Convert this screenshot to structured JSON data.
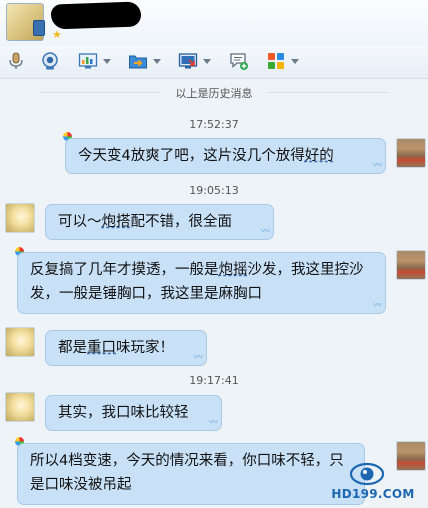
{
  "toolbar": {
    "items": [
      {
        "name": "voice-call-icon",
        "has_menu": false
      },
      {
        "name": "video-call-icon",
        "has_menu": false
      },
      {
        "name": "remote-desktop-icon",
        "has_menu": true
      },
      {
        "name": "send-file-icon",
        "has_menu": true
      },
      {
        "name": "screen-share-icon",
        "has_menu": true
      },
      {
        "name": "new-message-icon",
        "has_menu": false
      },
      {
        "name": "app-grid-icon",
        "has_menu": true
      }
    ]
  },
  "history_divider": "以上是历史消息",
  "timestamps": [
    "17:52:37",
    "19:05:13",
    "19:17:41"
  ],
  "messages": [
    {
      "sender": "self",
      "before": "今天变4放爽了吧，这片没几个放得",
      "underlined": "好的",
      "after": ""
    },
    {
      "sender": "other",
      "before": "可以～",
      "underlined": "炮搭",
      "after": "配不错，很全面"
    },
    {
      "sender": "self",
      "before": "反复搞了几年才摸透，一般是",
      "underlined": "炮摇",
      "after": "沙发，我这里控沙发，一般是锤胸口，我这里是麻胸口"
    },
    {
      "sender": "other",
      "before": "都是",
      "underlined": "重口",
      "after": "味玩家！"
    },
    {
      "sender": "other",
      "before": "其实，我口味比较轻",
      "underlined": "",
      "after": ""
    },
    {
      "sender": "self",
      "before": "所以4档变速，今天的情况来看，你口味不轻，只是口味没被吊起",
      "underlined": "",
      "after": ""
    }
  ],
  "watermark": "HD199.COM",
  "colors": {
    "bubble": "#c9e1f7",
    "bubble_border": "#a8c9e8",
    "background": "#eef3f8",
    "accent": "#1d67b2"
  }
}
